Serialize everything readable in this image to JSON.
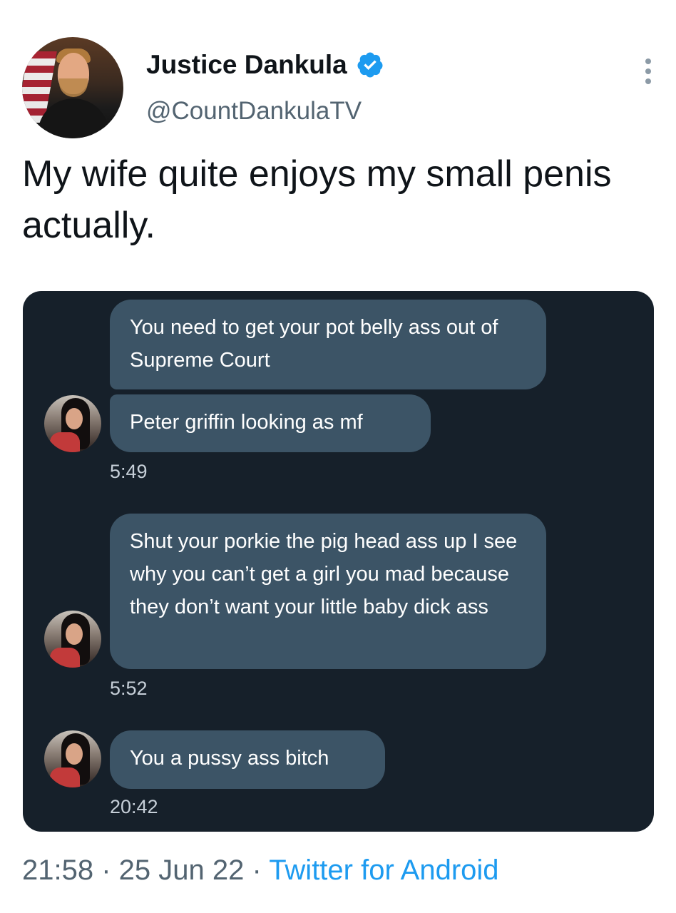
{
  "author": {
    "name": "Justice Dankula",
    "handle": "@CountDankulaTV",
    "verified": true
  },
  "tweet": {
    "text": "My wife quite enjoys my small penis actually."
  },
  "chat": {
    "messages": [
      {
        "text": "You need to get your pot belly ass out of Supreme Court"
      },
      {
        "text": "Peter griffin looking as mf"
      },
      {
        "text": "Shut your porkie the pig head ass up I see why you can’t get a girl you mad because they don’t want your little baby dick ass"
      },
      {
        "text": "You a pussy ass bitch"
      }
    ],
    "timestamps": [
      "5:49",
      "5:52",
      "20:42"
    ]
  },
  "footer": {
    "time": "21:58",
    "separator": " · ",
    "date": "25 Jun 22",
    "source": "Twitter for Android"
  },
  "colors": {
    "accent": "#1d9bf0",
    "chat_bg": "#16202a",
    "bubble": "#3c5466",
    "secondary_text": "#536471"
  },
  "icons": [
    "verified-badge-icon",
    "more-options-icon"
  ]
}
